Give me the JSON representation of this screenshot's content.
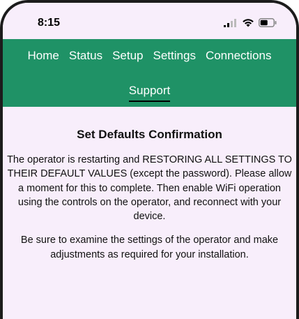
{
  "status_bar": {
    "time": "8:15",
    "icons": [
      "signal-icon",
      "wifi-icon",
      "battery-icon"
    ]
  },
  "nav": {
    "items": [
      "Home",
      "Status",
      "Setup",
      "Settings",
      "Connections"
    ],
    "active": "Support",
    "background": "#1f9266"
  },
  "content": {
    "title": "Set Defaults Confirmation",
    "paragraph1": "The operator is restarting and RESTORING ALL SETTINGS TO THEIR DEFAULT VALUES (except the password). Please allow a moment for this to complete. Then enable WiFi operation using the controls on the operator, and reconnect with your device.",
    "paragraph2": "Be sure to examine the settings of the operator and make adjustments as required for your installation."
  },
  "colors": {
    "page_bg": "#f8eefb",
    "text": "#111111"
  }
}
